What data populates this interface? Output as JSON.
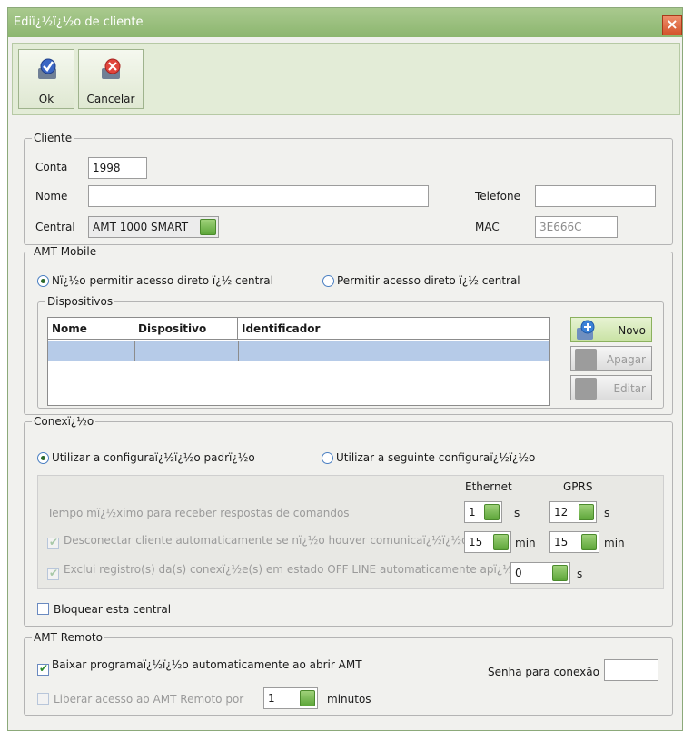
{
  "window": {
    "title": "Ediï¿½ï¿½o de cliente",
    "close_label": "×"
  },
  "toolbar": {
    "ok_label": "Ok",
    "cancel_label": "Cancelar"
  },
  "cliente": {
    "legend": "Cliente",
    "conta_label": "Conta",
    "conta_value": "1998",
    "nome_label": "Nome",
    "nome_value": "",
    "telefone_label": "Telefone",
    "telefone_value": "",
    "central_label": "Central",
    "central_value": "AMT 1000 SMART",
    "mac_label": "MAC",
    "mac_value": "3E666C"
  },
  "amt_mobile": {
    "legend": "AMT Mobile",
    "radio_no_direct": "Nï¿½o permitir acesso direto ï¿½ central",
    "radio_direct": "Permitir acesso direto ï¿½ central",
    "dispositivos_legend": "Dispositivos",
    "columns": [
      "Nome",
      "Dispositivo",
      "Identificador"
    ],
    "btn_novo": "Novo",
    "btn_apagar": "Apagar",
    "btn_editar": "Editar"
  },
  "conexao": {
    "legend": "Conexï¿½o",
    "radio_default": "Utilizar a configuraï¿½ï¿½o padrï¿½o",
    "radio_custom": "Utilizar a seguinte configuraï¿½ï¿½o",
    "col_ethernet": "Ethernet",
    "col_gprs": "GPRS",
    "row1_label": "Tempo mï¿½ximo para receber respostas de comandos",
    "row1_eth": "1",
    "row1_eth_unit": "s",
    "row1_gprs": "12",
    "row1_gprs_unit": "s",
    "row2_label": "Desconectar cliente automaticamente se nï¿½o houver comunicaï¿½ï¿½o",
    "row2_eth": "15",
    "row2_eth_unit": "min",
    "row2_gprs": "15",
    "row2_gprs_unit": "min",
    "row3_label": "Exclui registro(s) da(s) conexï¿½e(s) em estado OFF LINE automaticamente apï¿½",
    "row3_val": "0",
    "row3_unit": "s",
    "block_label": "Bloquear esta central"
  },
  "amt_remoto": {
    "legend": "AMT Remoto",
    "baixar_label": "Baixar programaï¿½ï¿½o automaticamente ao abrir AMT",
    "senha_label": "Senha para conexão",
    "senha_value": "",
    "liberar_label": "Liberar acesso ao AMT Remoto por",
    "liberar_value": "1",
    "liberar_unit": "minutos"
  },
  "colors": {
    "accent": "#8cb66f",
    "selected_row": "#b6cbe8"
  }
}
